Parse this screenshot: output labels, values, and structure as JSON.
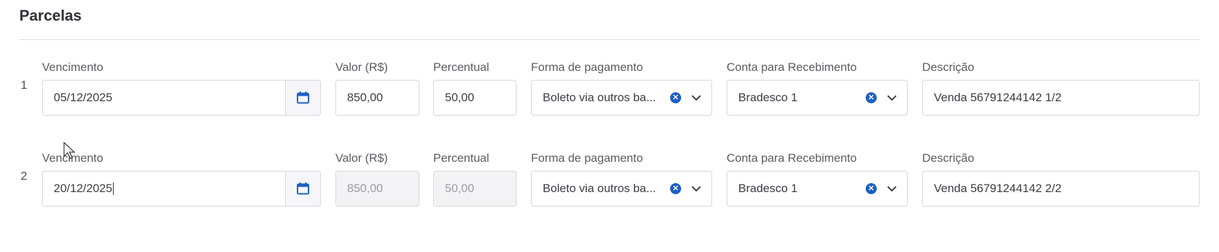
{
  "section": {
    "title": "Parcelas"
  },
  "labels": {
    "vencimento": "Vencimento",
    "valor": "Valor (R$)",
    "percentual": "Percentual",
    "forma": "Forma de pagamento",
    "conta": "Conta para Recebimento",
    "descricao": "Descrição"
  },
  "rows": [
    {
      "index": "1",
      "vencimento": "05/12/2025",
      "valor": "850,00",
      "percentual": "50,00",
      "forma": "Boleto via outros ba...",
      "conta": "Bradesco 1",
      "descricao": "Venda 56791244142 1/2"
    },
    {
      "index": "2",
      "vencimento": "20/12/2025",
      "valor": "850,00",
      "percentual": "50,00",
      "forma": "Boleto via outros ba...",
      "conta": "Bradesco 1",
      "descricao": "Venda 56791244142 2/2"
    }
  ],
  "icons": {
    "calendar": "calendar-icon",
    "clear": "clear-icon",
    "chevron": "chevron-down-icon"
  },
  "colors": {
    "accent": "#1d5fc4"
  }
}
